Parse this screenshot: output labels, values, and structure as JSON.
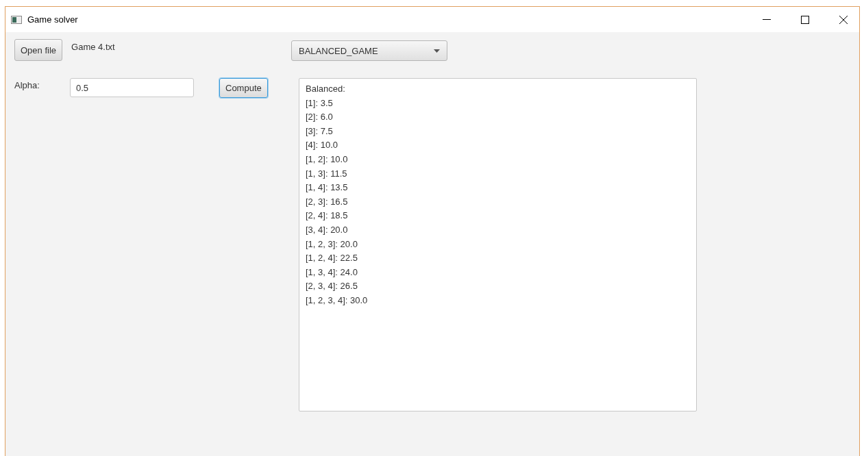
{
  "window": {
    "title": "Game solver"
  },
  "open_button": "Open file",
  "file_name": "Game 4.txt",
  "game_type": {
    "value": "BALANCED_GAME"
  },
  "alpha": {
    "label": "Alpha:",
    "value": "0.5"
  },
  "compute_button": {
    "label": "Compute",
    "focused": true
  },
  "output": {
    "lines": [
      "Balanced:",
      "[1]: 3.5",
      "[2]: 6.0",
      "[3]: 7.5",
      "[4]: 10.0",
      "[1, 2]: 10.0",
      "[1, 3]: 11.5",
      "[1, 4]: 13.5",
      "[2, 3]: 16.5",
      "[2, 4]: 18.5",
      "[3, 4]: 20.0",
      "[1, 2, 3]: 20.0",
      "[1, 2, 4]: 22.5",
      "[1, 3, 4]: 24.0",
      "[2, 3, 4]: 26.5",
      "[1, 2, 3, 4]: 30.0"
    ]
  }
}
